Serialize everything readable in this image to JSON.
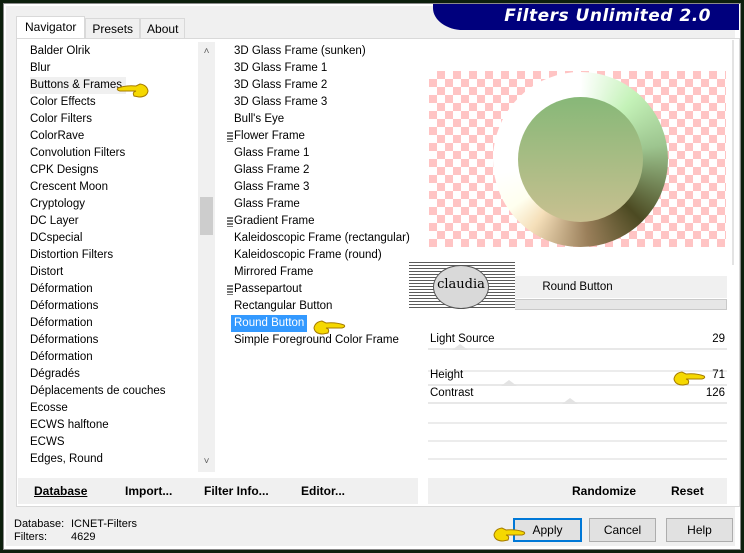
{
  "window": {
    "title_banner": "Filters Unlimited 2.0"
  },
  "tabs": [
    {
      "label": "Navigator",
      "active": true
    },
    {
      "label": "Presets",
      "active": false
    },
    {
      "label": "About",
      "active": false
    }
  ],
  "categories": {
    "highlighted": "Buttons & Frames",
    "items": [
      "Balder Olrik",
      "Blur",
      "Buttons & Frames",
      "Color Effects",
      "Color Filters",
      "ColorRave",
      "Convolution Filters",
      "CPK Designs",
      "Crescent Moon",
      "Cryptology",
      "DC Layer",
      "DCspecial",
      "Distortion Filters",
      "Distort",
      "Déformation",
      "Déformations",
      "Déformation",
      "Déformations",
      "Déformation",
      "Dégradés",
      "Déplacements de couches",
      "Ecosse",
      "ECWS halftone",
      "ECWS",
      "Edges, Round"
    ]
  },
  "filters": {
    "selected": "Round Button",
    "items": [
      {
        "label": "3D Glass Frame (sunken)",
        "marker": false
      },
      {
        "label": "3D Glass Frame 1",
        "marker": false
      },
      {
        "label": "3D Glass Frame 2",
        "marker": false
      },
      {
        "label": "3D Glass Frame 3",
        "marker": false
      },
      {
        "label": "Bull's Eye",
        "marker": false
      },
      {
        "label": "Flower Frame",
        "marker": true
      },
      {
        "label": "Glass Frame 1",
        "marker": false
      },
      {
        "label": "Glass Frame 2",
        "marker": false
      },
      {
        "label": "Glass Frame 3",
        "marker": false
      },
      {
        "label": "Glass Frame",
        "marker": false
      },
      {
        "label": "Gradient Frame",
        "marker": true
      },
      {
        "label": "Kaleidoscopic Frame (rectangular)",
        "marker": false
      },
      {
        "label": "Kaleidoscopic Frame (round)",
        "marker": false
      },
      {
        "label": "Mirrored Frame",
        "marker": false
      },
      {
        "label": "Passepartout",
        "marker": true
      },
      {
        "label": "Rectangular Button",
        "marker": false
      },
      {
        "label": "Round Button",
        "marker": false
      },
      {
        "label": "Simple Foreground Color Frame",
        "marker": false
      }
    ]
  },
  "preview": {
    "filter_name": "Round Button",
    "watermark": "claudia"
  },
  "parameters": [
    {
      "label": "Light Source",
      "value": "29",
      "fraction": 0.11
    },
    {
      "label": "Height",
      "value": "71",
      "fraction": 0.28
    },
    {
      "label": "Contrast",
      "value": "126",
      "fraction": 0.49
    }
  ],
  "left_buttons": {
    "database": "Database",
    "import": "Import...",
    "filter_info": "Filter Info...",
    "editor": "Editor..."
  },
  "right_buttons": {
    "randomize": "Randomize",
    "reset": "Reset"
  },
  "status": {
    "database_label": "Database:",
    "database_value": "ICNET-Filters",
    "filters_label": "Filters:",
    "filters_value": "4629"
  },
  "dialog_buttons": {
    "apply": "Apply",
    "cancel": "Cancel",
    "help": "Help"
  },
  "colors": {
    "selection": "#3399ff",
    "banner": "#00007d",
    "default_button_border": "#0078d7"
  }
}
